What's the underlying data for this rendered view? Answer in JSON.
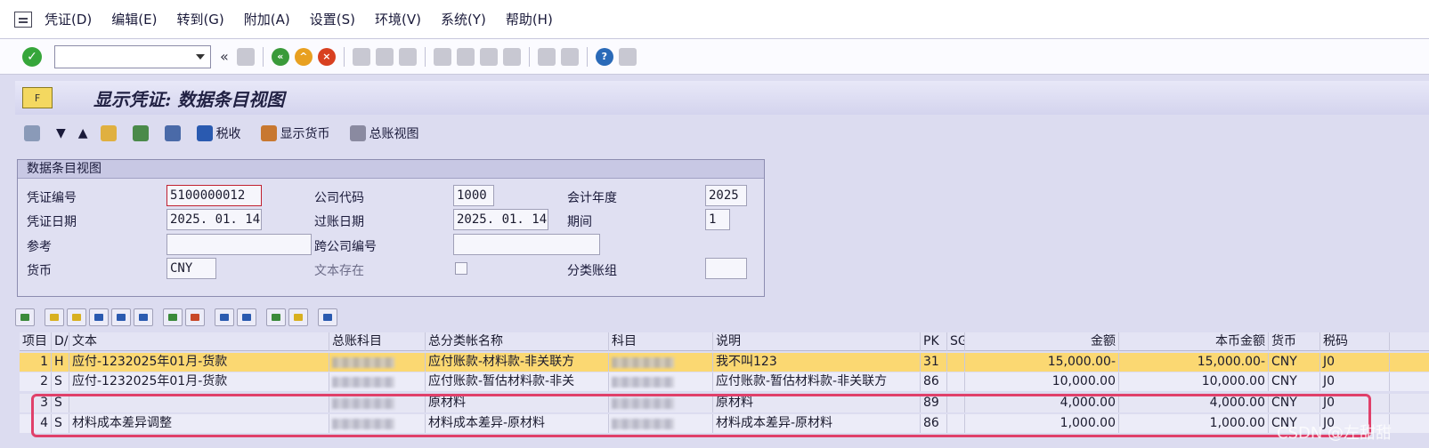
{
  "menu": [
    "凭证(D)",
    "编辑(E)",
    "转到(G)",
    "附加(A)",
    "设置(S)",
    "环境(V)",
    "系统(Y)",
    "帮助(H)"
  ],
  "title": "显示凭证: 数据条目视图",
  "app_toolbar": {
    "tax": "税收",
    "display_currency": "显示货币",
    "gl_view": "总账视图"
  },
  "header": {
    "section_title": "数据条目视图",
    "doc_no_label": "凭证编号",
    "doc_no": "5100000012",
    "company_label": "公司代码",
    "company": "1000",
    "fiscal_year_label": "会计年度",
    "fiscal_year": "2025",
    "doc_date_label": "凭证日期",
    "doc_date": "2025. 01. 14",
    "posting_date_label": "过账日期",
    "posting_date": "2025. 01. 14",
    "period_label": "期间",
    "period": "1",
    "reference_label": "参考",
    "cross_company_label": "跨公司编号",
    "currency_label": "货币",
    "currency": "CNY",
    "text_exists_label": "文本存在",
    "ledger_group_label": "分类账组"
  },
  "table": {
    "columns": [
      "项目",
      "D/",
      "文本",
      "总账科目",
      "总分类帐名称",
      "科目",
      "说明",
      "PK",
      "SG",
      "金额",
      "本币金额",
      "货币",
      "税码"
    ],
    "rows": [
      [
        "1",
        "H",
        "应付-1232025年01月-货款",
        "",
        "应付账款-材料款-非关联方",
        "",
        "我不叫123",
        "31",
        "",
        "15,000.00-",
        "15,000.00-",
        "CNY",
        "J0"
      ],
      [
        "2",
        "S",
        "应付-1232025年01月-货款",
        "",
        "应付账款-暂估材料款-非关",
        "",
        "应付账款-暂估材料款-非关联方",
        "86",
        "",
        "10,000.00",
        "10,000.00",
        "CNY",
        "J0"
      ],
      [
        "3",
        "S",
        "",
        "",
        "原材料",
        "",
        "原材料",
        "89",
        "",
        "4,000.00",
        "4,000.00",
        "CNY",
        "J0"
      ],
      [
        "4",
        "S",
        "材料成本差异调整",
        "",
        "材料成本差异-原材料",
        "",
        "材料成本差异-原材料",
        "86",
        "",
        "1,000.00",
        "1,000.00",
        "CNY",
        "J0"
      ]
    ]
  },
  "watermark": "CSDN @左甜甜"
}
